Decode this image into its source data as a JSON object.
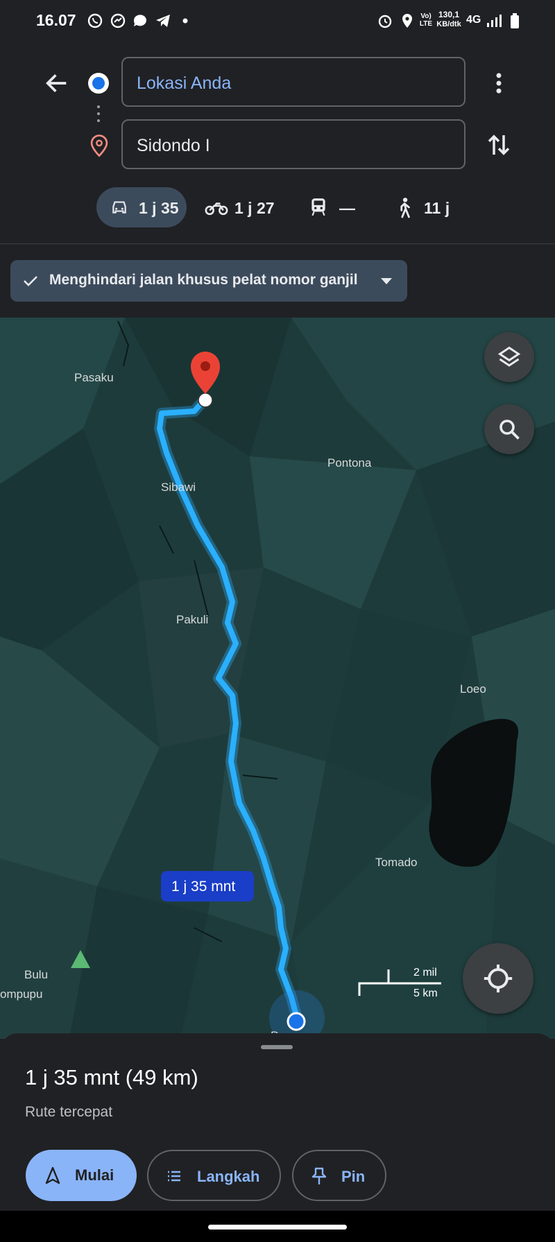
{
  "status_bar": {
    "time": "16.07",
    "network_label": "Vo) LTE",
    "speed_value": "130,1",
    "speed_unit": "KB/dtk",
    "network_type": "4G"
  },
  "directions": {
    "origin": "Lokasi Anda",
    "destination": "Sidondo I",
    "modes": [
      {
        "name": "car",
        "label": "1 j 35",
        "icon": "car-icon"
      },
      {
        "name": "motorcycle",
        "label": "1 j 27",
        "icon": "motorcycle-icon"
      },
      {
        "name": "transit",
        "label": "—",
        "icon": "train-icon"
      },
      {
        "name": "walk",
        "label": "11 j",
        "icon": "walk-icon"
      }
    ]
  },
  "filter_chip": {
    "label": "Menghindari jalan khusus pelat nomor ganjil"
  },
  "map": {
    "places": [
      "Pasaku",
      "Pontona",
      "Sibawi",
      "Pakuli",
      "Loeo",
      "Tomado",
      "Bulu",
      "ompupu",
      "Pangana"
    ],
    "route_label": "1 j 35 mnt",
    "scale_imperial": "2 mil",
    "scale_metric": "5 km"
  },
  "summary": {
    "duration": "1 j 35 mnt (49 km)",
    "route_type": "Rute tercepat"
  },
  "actions": {
    "start": "Mulai",
    "steps": "Langkah",
    "pin": "Pin"
  },
  "colors": {
    "accent_blue": "#8ab4f8",
    "route_blue": "#2ab0ff",
    "destination_red": "#ea4335",
    "chip_bg": "#3c4b5c"
  }
}
